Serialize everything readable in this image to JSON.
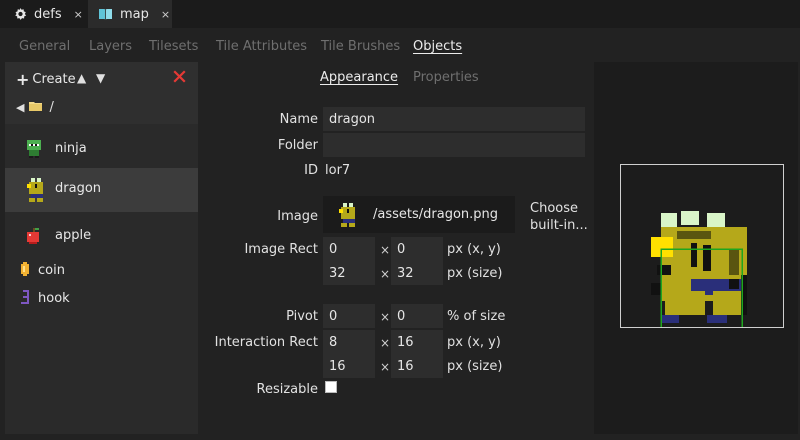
{
  "file_tabs": [
    {
      "label": "defs",
      "close": "×",
      "icon": "gear-icon"
    },
    {
      "label": "map",
      "close": "×",
      "icon": "map-book-icon"
    }
  ],
  "section_tabs": [
    "General",
    "Layers",
    "Tilesets",
    "Tile Attributes",
    "Tile Brushes",
    "Objects"
  ],
  "active_section_tab": "Objects",
  "toolbar": {
    "create_label": "Create",
    "up": "▲",
    "down": "▼"
  },
  "path": {
    "back": "◀",
    "current": "/"
  },
  "objects": [
    {
      "name": "ninja",
      "icon": "ninja-sprite-icon"
    },
    {
      "name": "dragon",
      "icon": "dragon-sprite-icon",
      "selected": true
    },
    {
      "name": "apple",
      "icon": "apple-sprite-icon"
    },
    {
      "name": "coin",
      "icon": "coin-sprite-icon"
    },
    {
      "name": "hook",
      "icon": "hook-sprite-icon"
    }
  ],
  "inner_tabs": {
    "appearance": "Appearance",
    "properties": "Properties",
    "active": "Appearance"
  },
  "form": {
    "name_label": "Name",
    "name_value": "dragon",
    "folder_label": "Folder",
    "folder_value": "",
    "id_label": "ID",
    "id_value": "lor7",
    "image_label": "Image",
    "image_path": "/assets/dragon.png",
    "choose_line1": "Choose",
    "choose_line2": "built-in...",
    "image_rect_label": "Image Rect",
    "image_rect": {
      "x": "0",
      "y": "0",
      "w": "32",
      "h": "32"
    },
    "pivot_label": "Pivot",
    "pivot": {
      "x": "0",
      "y": "0"
    },
    "interaction_rect_label": "Interaction Rect",
    "interaction_rect": {
      "x": "8",
      "y": "16",
      "w": "16",
      "h": "16"
    },
    "resizable_label": "Resizable",
    "resizable": false,
    "mul": "×",
    "unit_xy": "px (x, y)",
    "unit_size": "px (size)",
    "unit_pct": "% of size"
  },
  "colors": {
    "accent_red": "#e53935",
    "dragon_body": "#b5a81a",
    "interaction_rect": "#1fa51f"
  }
}
